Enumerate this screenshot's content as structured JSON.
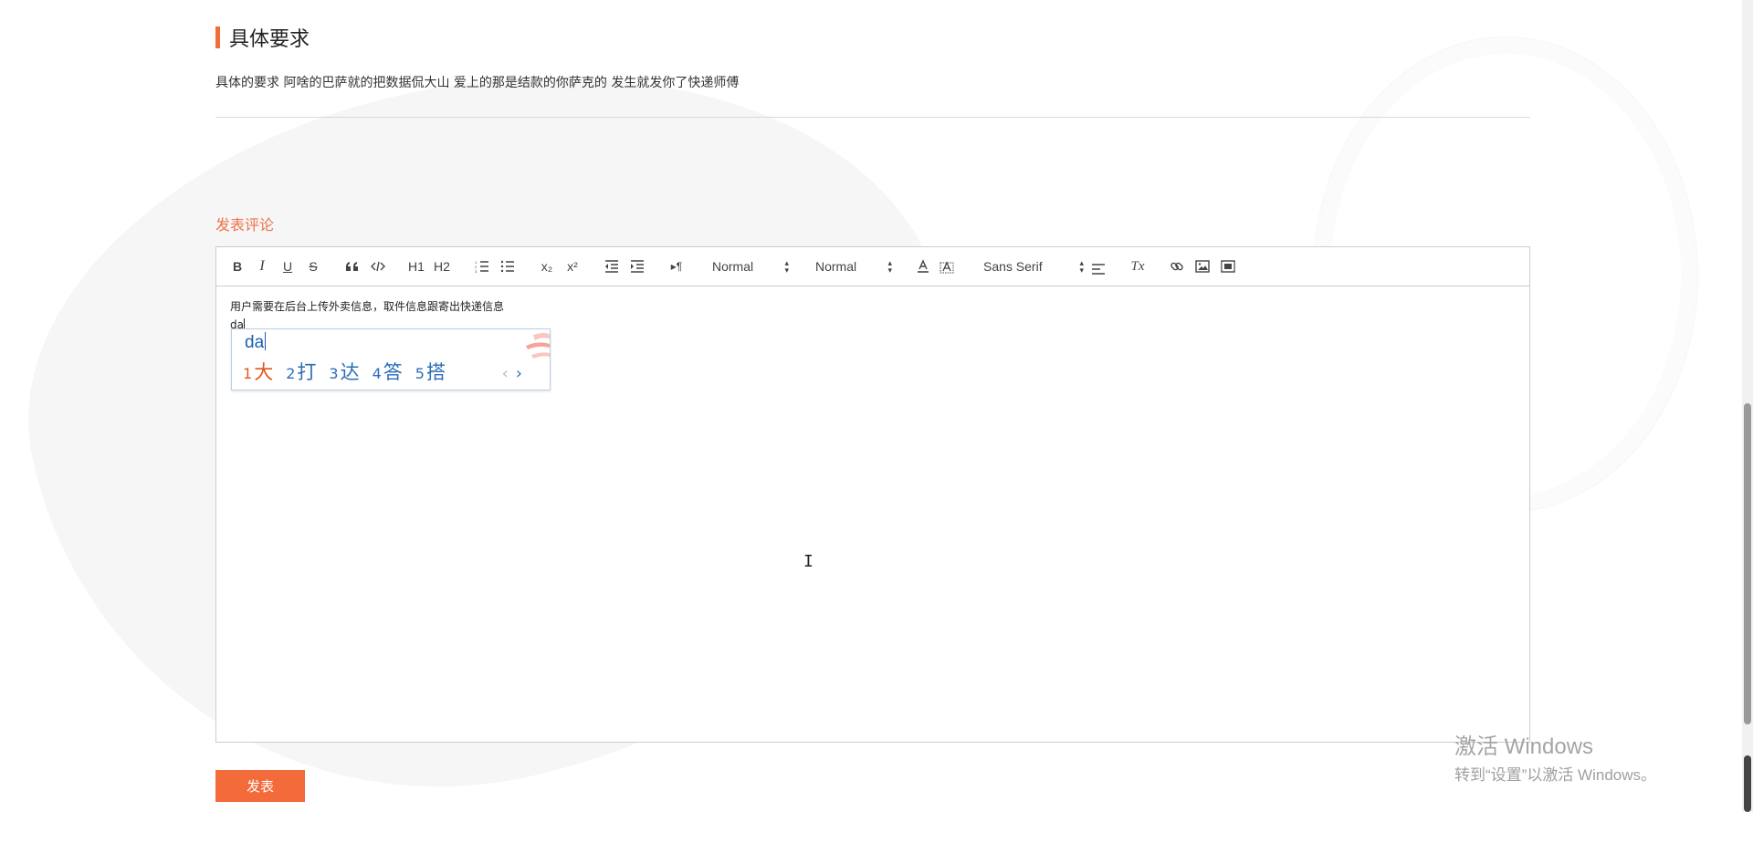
{
  "section": {
    "title": "具体要求",
    "description": "具体的要求 阿啥的巴萨就的把数据侃大山 爱上的那是结款的你萨克的 发生就发你了快递师傅"
  },
  "comment": {
    "label": "发表评论"
  },
  "editor": {
    "toolbar": {
      "bold": "B",
      "italic": "I",
      "underline": "U",
      "strike": "S",
      "h1": "H1",
      "h2": "H2",
      "sub": "x₂",
      "sup": "x²",
      "direction": "▸¶",
      "size_select": "Normal",
      "header_select": "Normal",
      "font_select": "Sans Serif",
      "clean": "Tx"
    },
    "content": {
      "line1": "用户需要在后台上传外卖信息，取件信息跟寄出快递信息",
      "line2": "da"
    }
  },
  "ime": {
    "composition": "da",
    "candidates": [
      {
        "num": "1",
        "text": "大"
      },
      {
        "num": "2",
        "text": "打"
      },
      {
        "num": "3",
        "text": "达"
      },
      {
        "num": "4",
        "text": "答"
      },
      {
        "num": "5",
        "text": "搭"
      }
    ],
    "prev": "‹",
    "next": "›"
  },
  "submit_label": "发表",
  "watermark": {
    "line1": "激活 Windows",
    "line2": "转到“设置”以激活 Windows。"
  },
  "colors": {
    "accent": "#f36a3b",
    "comment_label": "#f0714a",
    "ime_blue": "#2a6eb8",
    "ime_first": "#e2561e"
  }
}
